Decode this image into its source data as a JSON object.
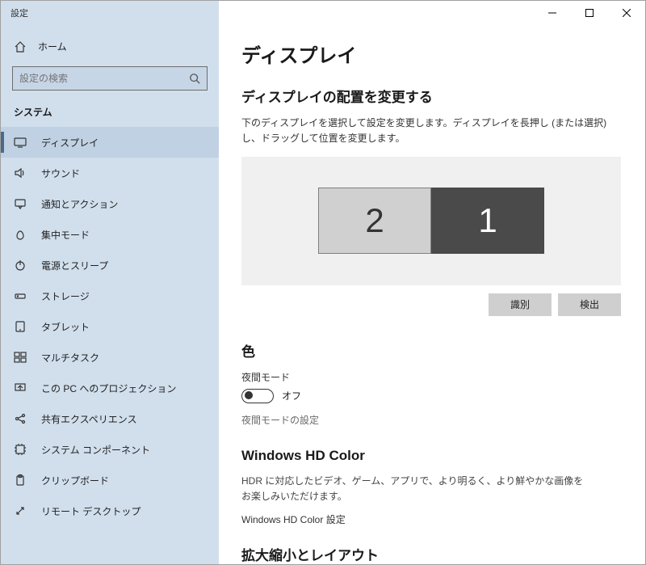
{
  "window": {
    "title": "設定"
  },
  "sidebar": {
    "home_label": "ホーム",
    "search_placeholder": "設定の検索",
    "group_label": "システム",
    "items": [
      {
        "label": "ディスプレイ",
        "icon": "display",
        "selected": true
      },
      {
        "label": "サウンド",
        "icon": "sound",
        "selected": false
      },
      {
        "label": "通知とアクション",
        "icon": "notifications",
        "selected": false
      },
      {
        "label": "集中モード",
        "icon": "focus",
        "selected": false
      },
      {
        "label": "電源とスリープ",
        "icon": "power",
        "selected": false
      },
      {
        "label": "ストレージ",
        "icon": "storage",
        "selected": false
      },
      {
        "label": "タブレット",
        "icon": "tablet",
        "selected": false
      },
      {
        "label": "マルチタスク",
        "icon": "multitask",
        "selected": false
      },
      {
        "label": "この PC へのプロジェクション",
        "icon": "projection",
        "selected": false
      },
      {
        "label": "共有エクスペリエンス",
        "icon": "shared",
        "selected": false
      },
      {
        "label": "システム コンポーネント",
        "icon": "components",
        "selected": false
      },
      {
        "label": "クリップボード",
        "icon": "clipboard",
        "selected": false
      },
      {
        "label": "リモート デスクトップ",
        "icon": "remote",
        "selected": false
      }
    ]
  },
  "main": {
    "page_title": "ディスプレイ",
    "arrangement": {
      "title": "ディスプレイの配置を変更する",
      "desc": "下のディスプレイを選択して設定を変更します。ディスプレイを長押し (または選択) し、ドラッグして位置を変更します。",
      "monitors": [
        {
          "num": "2",
          "style": "two"
        },
        {
          "num": "1",
          "style": "one"
        }
      ],
      "identify_label": "識別",
      "detect_label": "検出"
    },
    "color": {
      "title": "色",
      "night_mode_label": "夜間モード",
      "toggle_state": "オフ",
      "night_mode_settings": "夜間モードの設定"
    },
    "hdcolor": {
      "title": "Windows HD Color",
      "desc": "HDR に対応したビデオ、ゲーム、アプリで、より明るく、より鮮やかな画像をお楽しみいただけます。",
      "link": "Windows HD Color 設定"
    },
    "scale_title": "拡大縮小とレイアウト"
  }
}
